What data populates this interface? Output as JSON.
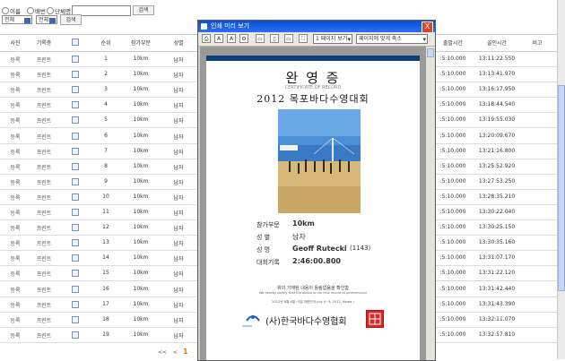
{
  "search": {
    "radio_options": [
      "이름",
      "배번",
      "단체명"
    ],
    "submit_label": "검색",
    "filter1": "전체",
    "filter2": "전체",
    "filter_submit_label": "검색"
  },
  "table": {
    "headers": [
      "사진",
      "기록증",
      "",
      "순위",
      "참가부문",
      "성별",
      "",
      "",
      "",
      "",
      "",
      "",
      "",
      "출발시간",
      "골인시간",
      "비고"
    ],
    "rows": [
      {
        "photo": "등록",
        "cert": "프린트",
        "rank": "1",
        "division": "10km",
        "gender": "남자",
        "start": ":5:10.000",
        "finish": "13:11:22.550"
      },
      {
        "photo": "등록",
        "cert": "프린트",
        "rank": "2",
        "division": "10km",
        "gender": "남자",
        "start": ":5:10.000",
        "finish": "13:13:41.970"
      },
      {
        "photo": "등록",
        "cert": "프린트",
        "rank": "3",
        "division": "10km",
        "gender": "남자",
        "start": ":5:10.000",
        "finish": "13:16:17.950"
      },
      {
        "photo": "등록",
        "cert": "프린트",
        "rank": "4",
        "division": "10km",
        "gender": "남자",
        "start": ":5:10.000",
        "finish": "13:18:44.540"
      },
      {
        "photo": "등록",
        "cert": "프린트",
        "rank": "5",
        "division": "10km",
        "gender": "남자",
        "start": ":5:10.000",
        "finish": "13:19:55.030"
      },
      {
        "photo": "등록",
        "cert": "프린트",
        "rank": "6",
        "division": "10km",
        "gender": "남자",
        "start": ":5:10.000",
        "finish": "13:20:09.670"
      },
      {
        "photo": "등록",
        "cert": "프린트",
        "rank": "7",
        "division": "10km",
        "gender": "남자",
        "start": ":5:10.000",
        "finish": "13:21:16.800"
      },
      {
        "photo": "등록",
        "cert": "프린트",
        "rank": "8",
        "division": "10km",
        "gender": "남자",
        "start": ":5:10.000",
        "finish": "13:25:52.920"
      },
      {
        "photo": "등록",
        "cert": "프린트",
        "rank": "9",
        "division": "10km",
        "gender": "남자",
        "start": ":5:10.000",
        "finish": "13:27:53.250"
      },
      {
        "photo": "등록",
        "cert": "프린트",
        "rank": "10",
        "division": "10km",
        "gender": "남자",
        "start": ":5:10.000",
        "finish": "13:28:35.210"
      },
      {
        "photo": "등록",
        "cert": "프린트",
        "rank": "11",
        "division": "10km",
        "gender": "남자",
        "start": ":5:10.000",
        "finish": "13:30:22.040"
      },
      {
        "photo": "등록",
        "cert": "프린트",
        "rank": "12",
        "division": "10km",
        "gender": "남자",
        "start": ":5:10.000",
        "finish": "13:30:25.150"
      },
      {
        "photo": "등록",
        "cert": "프린트",
        "rank": "13",
        "division": "10km",
        "gender": "남자",
        "start": ":5:10.000",
        "finish": "13:30:35.160"
      },
      {
        "photo": "등록",
        "cert": "프린트",
        "rank": "14",
        "division": "10km",
        "gender": "남자",
        "start": ":5:10.000",
        "finish": "13:31:07.170"
      },
      {
        "photo": "등록",
        "cert": "프린트",
        "rank": "15",
        "division": "10km",
        "gender": "남자",
        "start": ":5:10.000",
        "finish": "13:31:22.120"
      },
      {
        "photo": "등록",
        "cert": "프린트",
        "rank": "16",
        "division": "10km",
        "gender": "남자",
        "start": ":5:10.000",
        "finish": "13:31:42.440"
      },
      {
        "photo": "등록",
        "cert": "프린트",
        "rank": "17",
        "division": "10km",
        "gender": "남자",
        "start": ":5:10.000",
        "finish": "13:31:43.390"
      },
      {
        "photo": "등록",
        "cert": "프린트",
        "rank": "18",
        "division": "10km",
        "gender": "남자",
        "start": ":5:10.000",
        "finish": "13:32:11.070"
      },
      {
        "photo": "등록",
        "cert": "프린트",
        "rank": "19",
        "division": "10km",
        "gender": "남자",
        "start": ":5:10.000",
        "finish": "13:32:57.810"
      }
    ]
  },
  "pagination": {
    "first": "<<",
    "prev": "<",
    "current": "1"
  },
  "popup": {
    "title": "인쇄 미리 보기",
    "page_view": "1 페이지 보기",
    "fit_option": "페이지에 맞게 축소",
    "close_label": "X"
  },
  "certificate": {
    "title": "완 영 증",
    "subtitle": "CERTIFICATE OF RECORD",
    "event": "2012 목포바다수영대회",
    "division_label": "참가부문",
    "division_value": "10km",
    "gender_label": "성 별",
    "gender_value": "남자",
    "name_label": "성 명",
    "name_value": "Geoff Rutecki",
    "bib": "(1143)",
    "record_label": "대회기록",
    "record_value": "2:46:00.800",
    "confirm_ko": "위의 기재된 내용이 틀림없음을 확인함",
    "confirm_en": "We hereby certify that the above is the true record of performance",
    "date_line": "2012년 8월 4일~5일 대한민국  July 4~5, 2012, Korea )",
    "org_name": "(사)한국바다수영협회",
    "logo_text": "AKOWS"
  }
}
